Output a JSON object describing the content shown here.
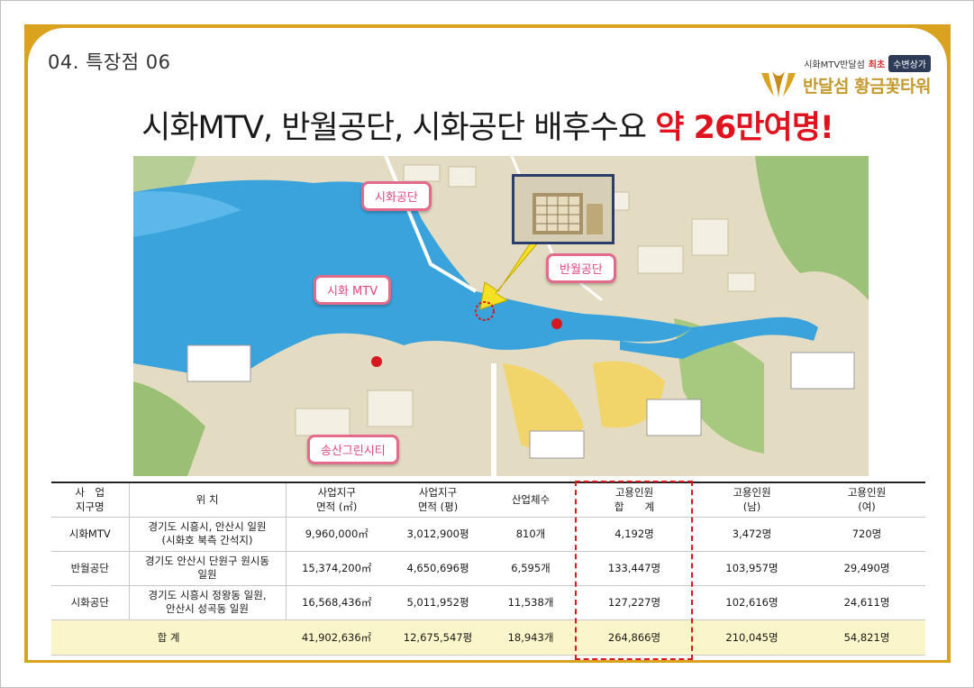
{
  "section": "04. 특장점 06",
  "logo": {
    "tagline_prefix": "시화MTV반달섬",
    "tagline_highlight": "최초",
    "badge": "수변상가",
    "name": "반달섬 황금꽃타워"
  },
  "headline": {
    "text": "시화MTV, 반월공단, 시화공단 배후수요",
    "highlight": "약 26만여명!"
  },
  "map": {
    "labels": {
      "sihwa_gongdan": "시화공단",
      "banwol_gongdan": "반월공단",
      "sihwa_mtv": "시화 MTV",
      "songsan": "송산그린시티"
    }
  },
  "table": {
    "headers": [
      [
        "사　업",
        "지구명"
      ],
      [
        "위 치"
      ],
      [
        "사업지구",
        "면적 (㎡)"
      ],
      [
        "사업지구",
        "면적 (평)"
      ],
      [
        "산업체수"
      ],
      [
        "고용인원",
        "합　　계"
      ],
      [
        "고용인원",
        "(남)"
      ],
      [
        "고용인원",
        "(여)"
      ]
    ],
    "rows": [
      [
        "시화MTV",
        "경기도 시흥시, 안산시 일원\n(시화호 북측 간석지)",
        "9,960,000㎡",
        "3,012,900평",
        "810개",
        "4,192명",
        "3,472명",
        "720명"
      ],
      [
        "반월공단",
        "경기도 안산시 단원구 원시동\n일원",
        "15,374,200㎡",
        "4,650,696평",
        "6,595개",
        "133,447명",
        "103,957명",
        "29,490명"
      ],
      [
        "시화공단",
        "경기도 시흥시 정왕동 일원,\n안산시 성곡동 일원",
        "16,568,436㎡",
        "5,011,952평",
        "11,538개",
        "127,227명",
        "102,616명",
        "24,611명"
      ]
    ],
    "total": {
      "label": "합 계",
      "values": [
        "41,902,636㎡",
        "12,675,547평",
        "18,943개",
        "264,866명",
        "210,045명",
        "54,821명"
      ]
    }
  },
  "colors": {
    "gold": "#d9a21f",
    "accent_red": "#e0121d",
    "label_pink": "#e36a8a",
    "total_row": "#fbf6c9"
  }
}
